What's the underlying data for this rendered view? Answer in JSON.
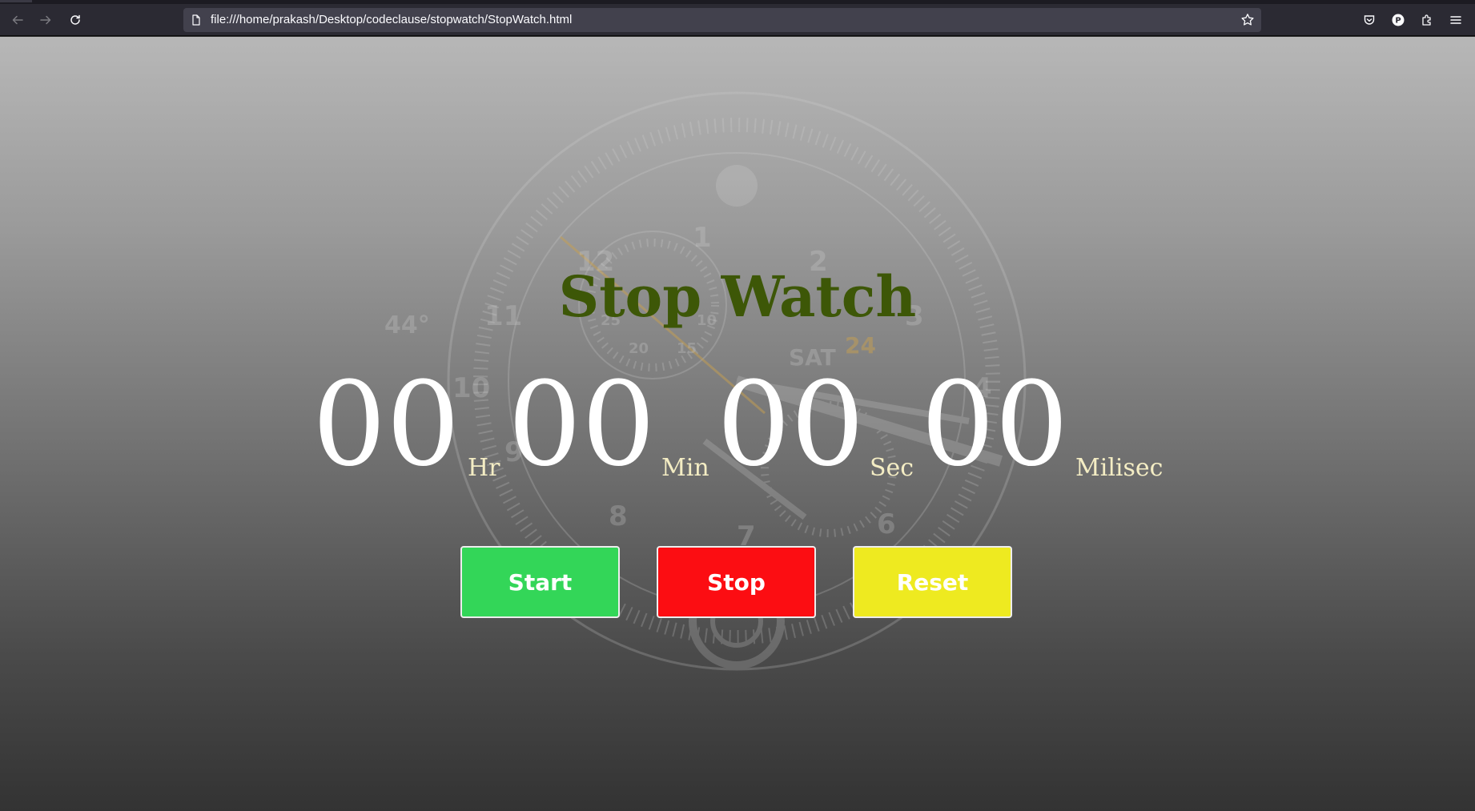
{
  "browser": {
    "url": "file:///home/prakash/Desktop/codeclause/stopwatch/StopWatch.html",
    "icons": [
      "back-arrow-icon",
      "forward-arrow-icon",
      "reload-icon",
      "page-icon",
      "bookmark-star-icon",
      "pocket-icon",
      "profile-icon",
      "extensions-icon",
      "menu-icon"
    ],
    "profile_initial": "P"
  },
  "page": {
    "title": "Stop Watch",
    "time": {
      "hours": "00",
      "hours_label": "Hr",
      "minutes": "00",
      "minutes_label": "Min",
      "seconds": "00",
      "seconds_label": "Sec",
      "milliseconds": "00",
      "milliseconds_label": "Milisec"
    },
    "buttons": {
      "start": "Start",
      "stop": "Stop",
      "reset": "Reset"
    },
    "colors": {
      "title": "#3d5707",
      "start": "#33d658",
      "stop": "#fc0d12",
      "reset": "#eeea20"
    }
  },
  "background_watch": {
    "numerals": [
      "12",
      "1",
      "2",
      "3",
      "4",
      "6",
      "7",
      "8",
      "9",
      "10",
      "11"
    ],
    "subdial_numerals": [
      "25",
      "20",
      "15",
      "10"
    ],
    "day": "SAT",
    "date": "24",
    "bezel_text": "44°"
  }
}
